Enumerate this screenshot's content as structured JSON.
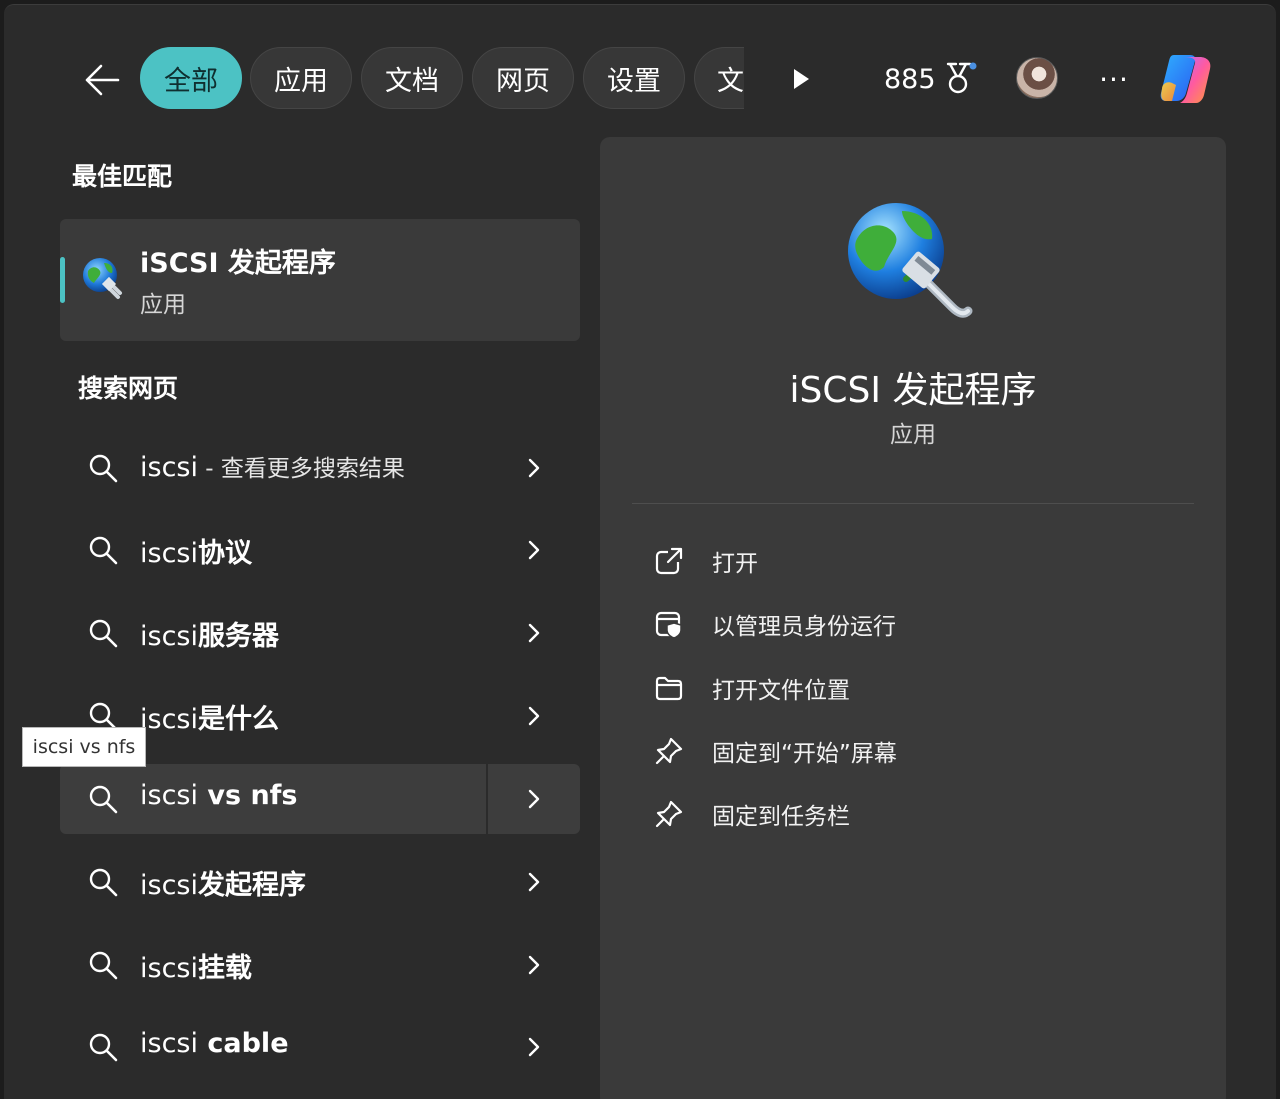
{
  "tabs": [
    {
      "label": "全部",
      "active": true
    },
    {
      "label": "应用",
      "active": false
    },
    {
      "label": "文档",
      "active": false
    },
    {
      "label": "网页",
      "active": false
    },
    {
      "label": "设置",
      "active": false
    },
    {
      "label": "文",
      "active": false
    }
  ],
  "header": {
    "points": "885",
    "back_icon": "arrow-left-icon",
    "play_icon": "play-icon",
    "medal_icon": "medal-icon",
    "more_label": "···",
    "copilot_icon": "copilot-icon"
  },
  "best_match": {
    "section_title": "最佳匹配",
    "title": "iSCSI 发起程序",
    "subtitle": "应用",
    "icon": "globe-network-icon"
  },
  "web_search": {
    "section_title": "搜索网页",
    "results": [
      {
        "prefix": "iscsi",
        "suffix": "",
        "note": " - 查看更多搜索结果"
      },
      {
        "prefix": "iscsi",
        "suffix": "协议",
        "note": ""
      },
      {
        "prefix": "iscsi",
        "suffix": "服务器",
        "note": ""
      },
      {
        "prefix": "iscsi",
        "suffix": "是什么",
        "note": ""
      },
      {
        "prefix": "iscsi",
        "suffix": " vs nfs",
        "note": "",
        "hovered": true
      },
      {
        "prefix": "iscsi",
        "suffix": "发起程序",
        "note": ""
      },
      {
        "prefix": "iscsi",
        "suffix": "挂载",
        "note": ""
      },
      {
        "prefix": "iscsi",
        "suffix": " cable",
        "note": ""
      }
    ]
  },
  "tooltip": "iscsi vs nfs",
  "detail": {
    "title": "iSCSI 发起程序",
    "type": "应用",
    "actions": [
      {
        "label": "打开",
        "icon": "open-external-icon"
      },
      {
        "label": "以管理员身份运行",
        "icon": "run-as-admin-icon"
      },
      {
        "label": "打开文件位置",
        "icon": "folder-icon"
      },
      {
        "label": "固定到“开始”屏幕",
        "icon": "pin-icon"
      },
      {
        "label": "固定到任务栏",
        "icon": "pin-icon"
      }
    ]
  },
  "colors": {
    "accent": "#4cc2c4",
    "background": "#2b2b2b",
    "panel": "#3a3a3a"
  }
}
